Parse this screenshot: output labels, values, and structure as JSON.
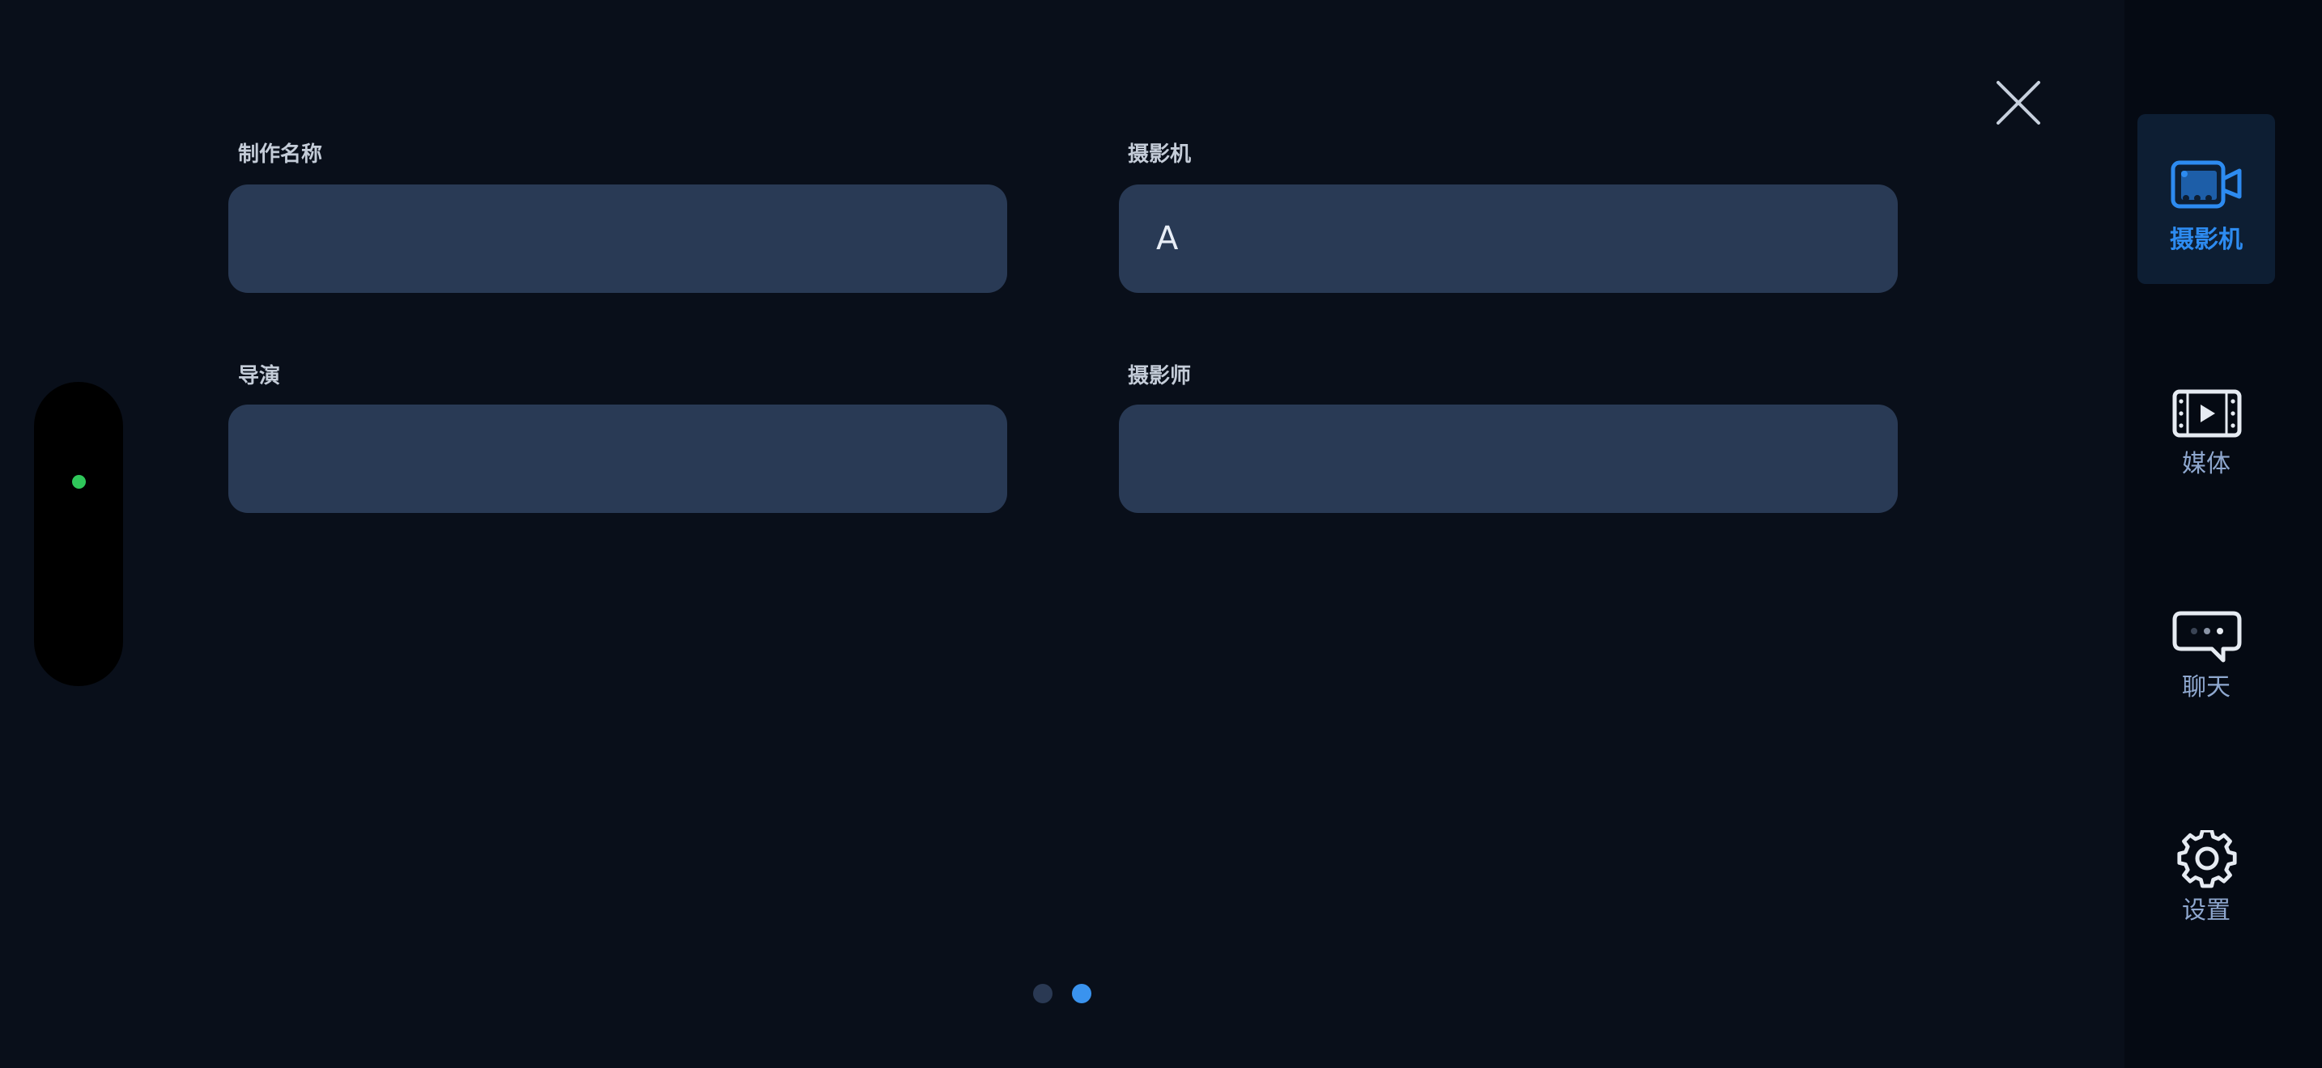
{
  "form": {
    "production_name": {
      "label": "制作名称",
      "value": ""
    },
    "camera": {
      "label": "摄影机",
      "value": "A"
    },
    "director": {
      "label": "导演",
      "value": ""
    },
    "cinematographer": {
      "label": "摄影师",
      "value": ""
    }
  },
  "pager": {
    "total": 2,
    "current": 2
  },
  "sidebar": {
    "items": [
      {
        "label": "摄影机",
        "icon": "video-camera-icon",
        "active": true
      },
      {
        "label": "媒体",
        "icon": "film-play-icon",
        "active": false
      },
      {
        "label": "聊天",
        "icon": "chat-bubble-icon",
        "active": false
      },
      {
        "label": "设置",
        "icon": "gear-icon",
        "active": false
      }
    ]
  },
  "colors": {
    "accent": "#2d8bf0",
    "background": "#090f1a",
    "sidebar_background": "#050a13",
    "input_background": "#293a55",
    "status_green": "#2fc75a"
  }
}
